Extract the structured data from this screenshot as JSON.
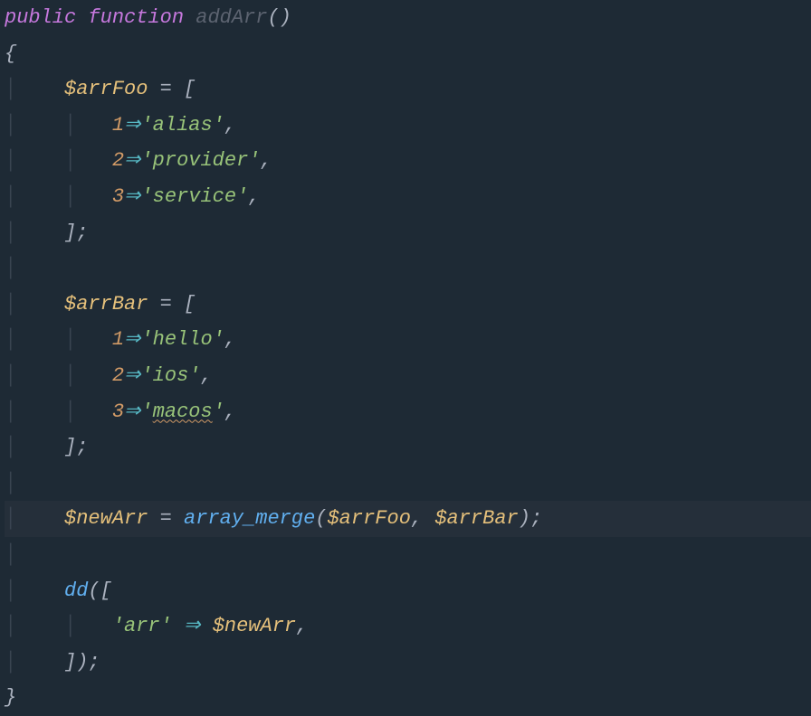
{
  "code": {
    "keyword_public": "public",
    "keyword_function": "function",
    "method_name": "addArr",
    "paren_open": "(",
    "paren_close": ")",
    "brace_open": "{",
    "brace_close": "}",
    "bracket_open": "[",
    "bracket_close": "]",
    "var_arrFoo": "$arrFoo",
    "var_arrBar": "$arrBar",
    "var_newArr": "$newArr",
    "equals": "=",
    "arrow": "⇒",
    "semicolon": ";",
    "comma": ",",
    "num_1": "1",
    "num_2": "2",
    "num_3": "3",
    "str_alias": "'alias'",
    "str_provider": "'provider'",
    "str_service": "'service'",
    "str_hello": "'hello'",
    "str_ios": "'ios'",
    "str_macos_open": "'",
    "str_macos": "macos",
    "str_macos_close": "'",
    "str_arr": "'arr'",
    "fn_array_merge": "array_merge",
    "fn_dd": "dd",
    "indent_pipe": "│"
  }
}
